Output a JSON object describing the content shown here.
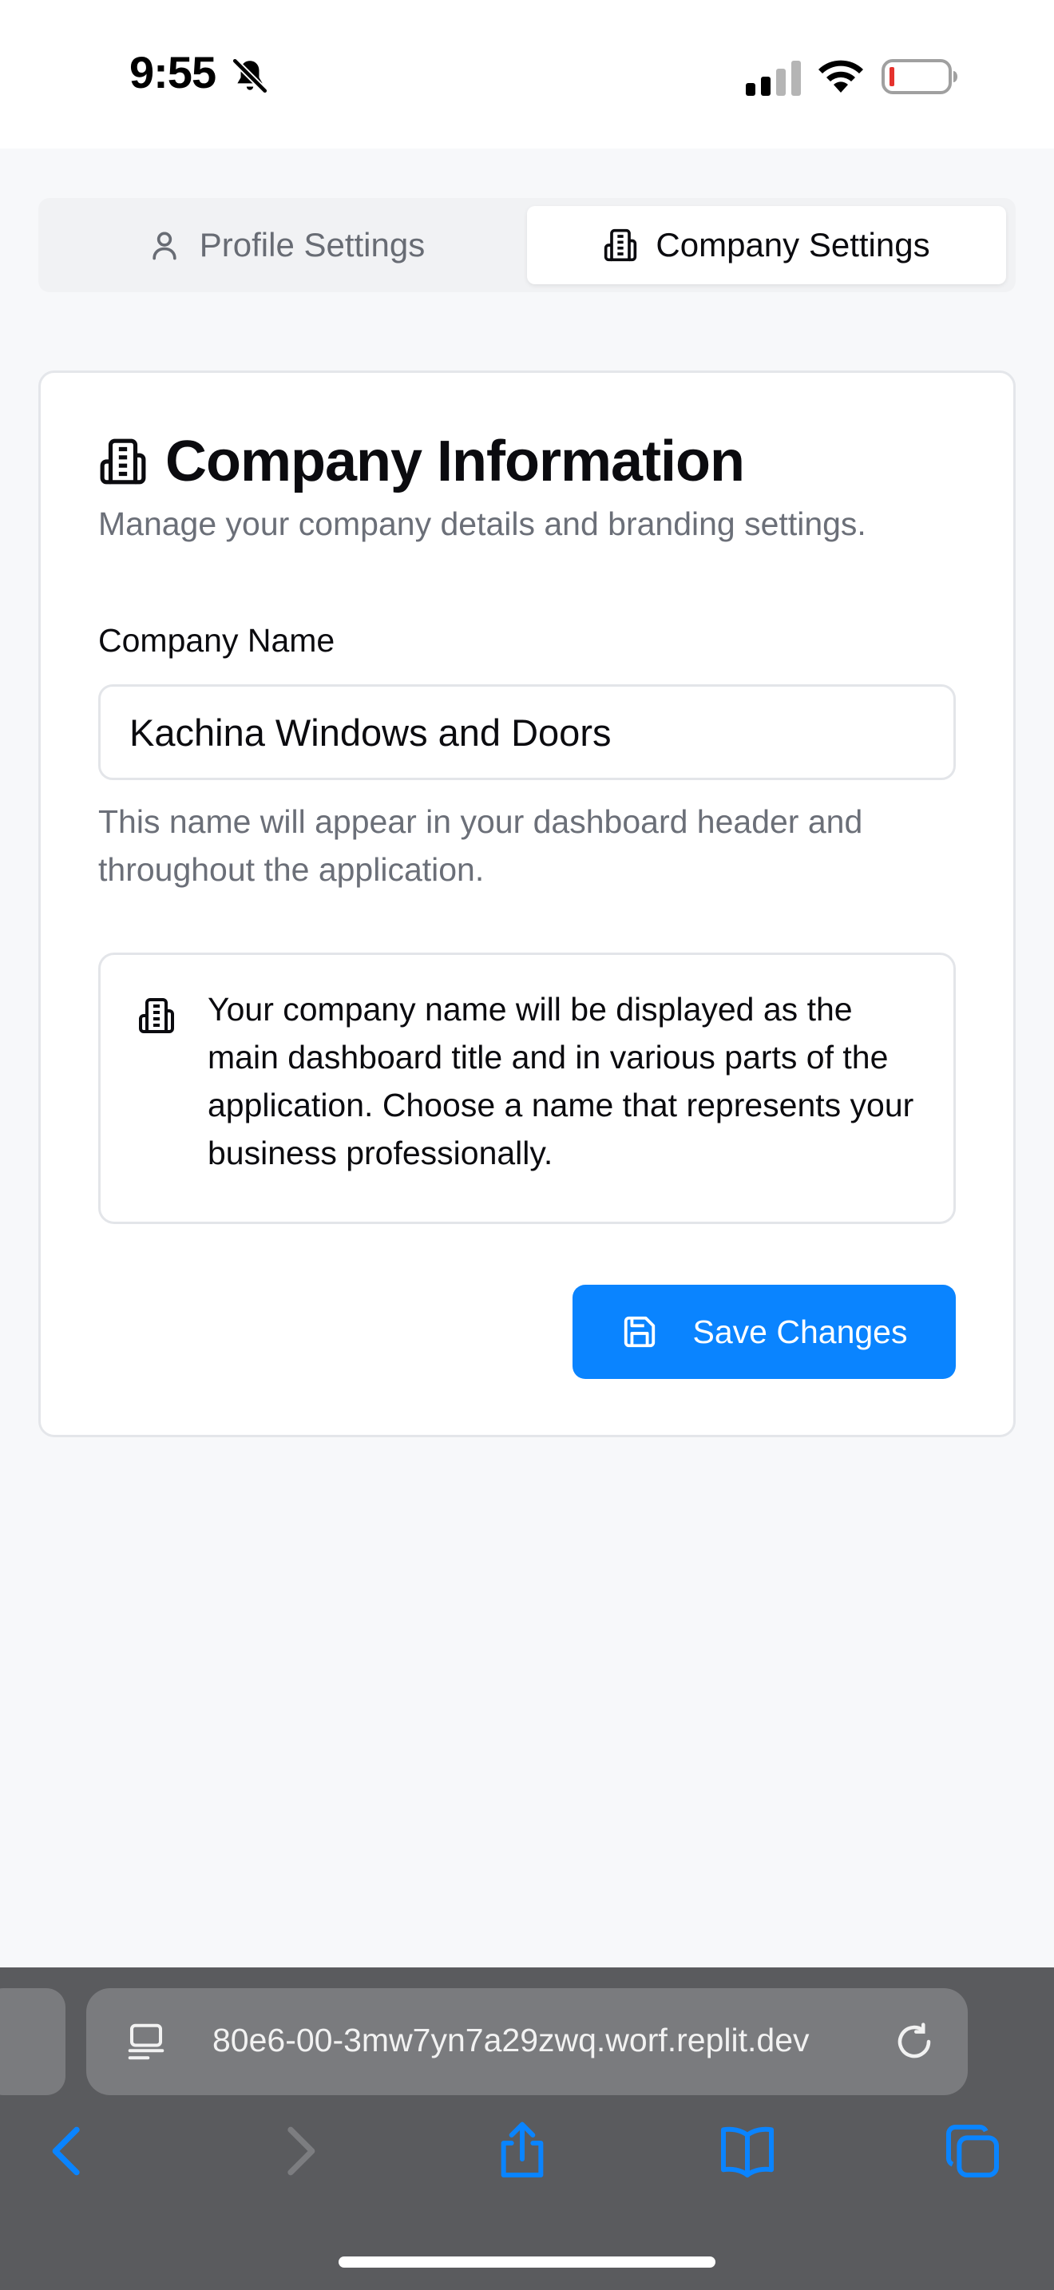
{
  "status_bar": {
    "time": "9:55",
    "icons": [
      "bell-slash-icon",
      "cellular-signal-icon",
      "wifi-icon",
      "battery-low-icon"
    ]
  },
  "tabs": [
    {
      "label": "Profile Settings",
      "icon": "user-icon",
      "active": false
    },
    {
      "label": "Company Settings",
      "icon": "building-icon",
      "active": true
    }
  ],
  "card": {
    "title": "Company Information",
    "description": "Manage your company details and branding settings.",
    "field": {
      "label": "Company Name",
      "value": "Kachina Windows and Doors",
      "help": "This name will appear in your dashboard header and throughout the application."
    },
    "info": "Your company name will be displayed as the main dashboard title and in various parts of the application. Choose a name that represents your business professionally.",
    "save_label": "Save Changes"
  },
  "browser": {
    "url": "80e6-00-3mw7yn7a29zwq.worf.replit.dev"
  },
  "colors": {
    "accent": "#0a84ff",
    "battery_low": "#e5322d"
  }
}
